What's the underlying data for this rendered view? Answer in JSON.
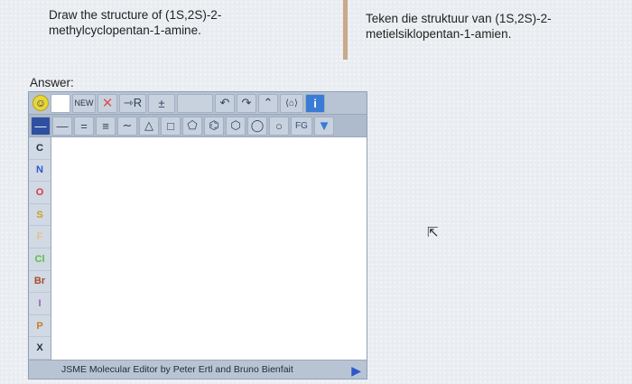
{
  "question": {
    "english": "Draw the structure of (1S,2S)-2-methylcyclopentan-1-amine.",
    "afrikaans": "Teken die struktuur van (1S,2S)-2-metielsiklopentan-1-amien."
  },
  "answer_label": "Answer:",
  "editor": {
    "row1": {
      "new_label": "NEW",
      "delete_glyph": "✕",
      "rgroup_label": "⇾R",
      "charge_label": "±",
      "undo_glyph": "↶",
      "redo_glyph": "↷",
      "up_glyph": "⌃",
      "template_glyph": "⟨⌂⟩",
      "info_label": "i"
    },
    "row2": {
      "single_bond": "—",
      "double_bond": "=",
      "triple_bond": "≡",
      "chain_glyph": "∼",
      "triangle": "△",
      "square": "□",
      "pentagon": "⬠",
      "benzene": "⌬",
      "hexagon": "⬡",
      "heptagon": "◯",
      "octagon": "○",
      "fg_label": "FG"
    },
    "atoms": [
      {
        "symbol": "C",
        "color": "#1d2d44"
      },
      {
        "symbol": "N",
        "color": "#2f55d4"
      },
      {
        "symbol": "O",
        "color": "#d83a3a"
      },
      {
        "symbol": "S",
        "color": "#c9a020"
      },
      {
        "symbol": "F",
        "color": "#e6c08a"
      },
      {
        "symbol": "Cl",
        "color": "#5cbf3a"
      },
      {
        "symbol": "Br",
        "color": "#a84a2a"
      },
      {
        "symbol": "I",
        "color": "#9e5fb0"
      },
      {
        "symbol": "P",
        "color": "#d07a20"
      },
      {
        "symbol": "X",
        "color": "#1d2d44"
      }
    ],
    "status_text": "JSME Molecular Editor by Peter Ertl and Bruno Bienfait"
  }
}
